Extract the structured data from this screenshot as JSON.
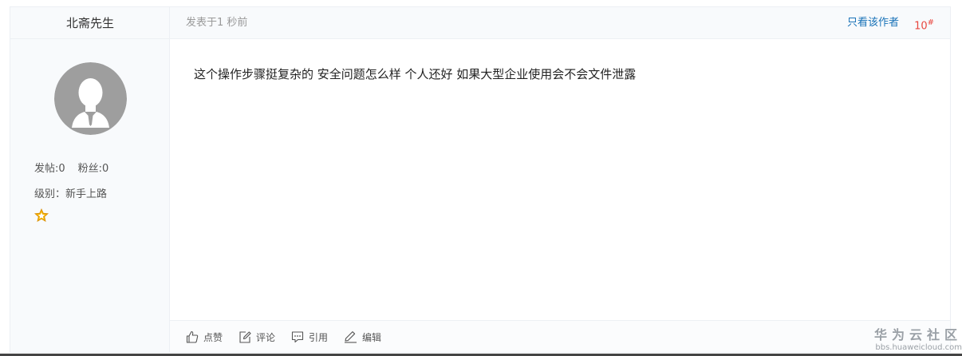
{
  "author": {
    "name": "北斋先生",
    "stats": {
      "posts_label": "发帖:0",
      "fans_label": "粉丝:0"
    },
    "level_label": "级别：新手上路",
    "level_icon": "star-icon",
    "avatar_icon": "default-user-avatar-icon"
  },
  "header": {
    "post_time": "发表于1 秒前",
    "only_author": "只看该作者",
    "floor_number": "10",
    "floor_mark": "#"
  },
  "content": {
    "text": "这个操作步骤挺复杂的  安全问题怎么样  个人还好 如果大型企业使用会不会文件泄露"
  },
  "footer": {
    "actions": [
      {
        "label": "点赞",
        "icon": "thumbs-up-icon"
      },
      {
        "label": "评论",
        "icon": "comment-edit-icon"
      },
      {
        "label": "引用",
        "icon": "quote-bubble-icon"
      },
      {
        "label": "编辑",
        "icon": "pencil-icon"
      }
    ]
  },
  "watermark": {
    "title": "华为云社区",
    "url": "bbs.huaweicloud.com"
  },
  "colors": {
    "link": "#1a73b8",
    "floor": "#e8473f",
    "panel_bg": "#f8fafc"
  }
}
